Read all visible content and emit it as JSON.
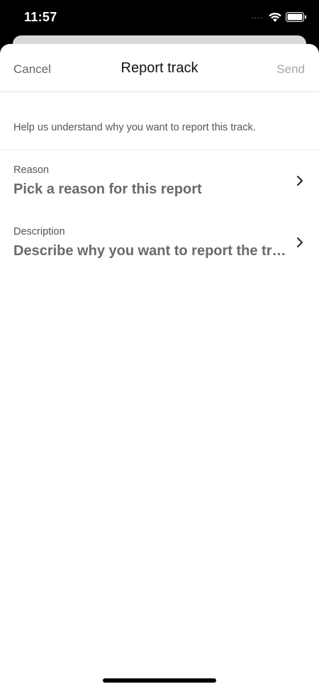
{
  "status_bar": {
    "time": "11:57",
    "signal_dots": "....",
    "icons": [
      "wifi-icon",
      "battery-icon"
    ]
  },
  "nav": {
    "cancel_label": "Cancel",
    "title": "Report track",
    "send_label": "Send"
  },
  "help_text": "Help us understand why you want to report this track.",
  "rows": [
    {
      "label": "Reason",
      "value": "Pick a reason for this report",
      "icon": "chevron-right-icon"
    },
    {
      "label": "Description",
      "value": "Describe why you want to report the track",
      "icon": "chevron-right-icon"
    }
  ],
  "colors": {
    "background": "#000000",
    "sheet": "#ffffff",
    "title_text": "#111111",
    "secondary_text": "#666666",
    "disabled_text": "#a6a6a6"
  }
}
